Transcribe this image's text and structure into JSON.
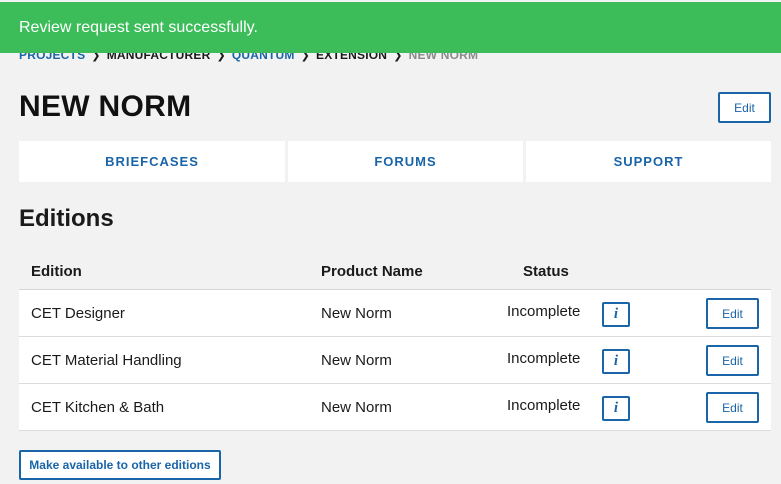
{
  "toast": {
    "message": "Review request sent successfully."
  },
  "breadcrumb": [
    {
      "label": "PROJECTS",
      "type": "link"
    },
    {
      "label": "MANUFACTURER",
      "type": "text"
    },
    {
      "label": "QUANTUM",
      "type": "link"
    },
    {
      "label": "EXTENSION",
      "type": "text"
    },
    {
      "label": "NEW NORM",
      "type": "current"
    }
  ],
  "header": {
    "title": "NEW NORM",
    "edit_label": "Edit"
  },
  "tabs": [
    {
      "label": "BRIEFCASES"
    },
    {
      "label": "FORUMS"
    },
    {
      "label": "SUPPORT"
    }
  ],
  "editions": {
    "title": "Editions",
    "columns": {
      "edition": "Edition",
      "product": "Product Name",
      "status": "Status"
    },
    "rows": [
      {
        "edition": "CET Designer",
        "product": "New Norm",
        "status": "Incomplete",
        "info": "i",
        "edit_label": "Edit"
      },
      {
        "edition": "CET Material Handling",
        "product": "New Norm",
        "status": "Incomplete",
        "info": "i",
        "edit_label": "Edit"
      },
      {
        "edition": "CET Kitchen & Bath",
        "product": "New Norm",
        "status": "Incomplete",
        "info": "i",
        "edit_label": "Edit"
      }
    ],
    "make_available_label": "Make available to other editions"
  },
  "colors": {
    "accent": "#1a64a8",
    "success": "#3dbd5a",
    "background": "#f2f2f2"
  }
}
